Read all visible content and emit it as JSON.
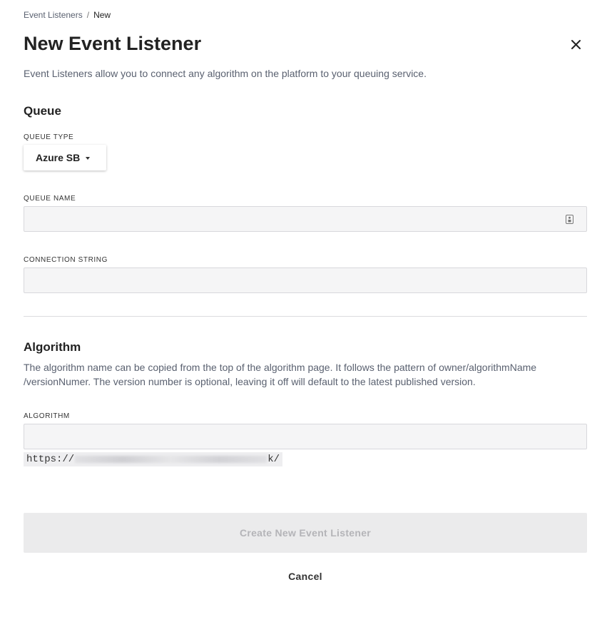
{
  "breadcrumb": {
    "parent": "Event Listeners",
    "separator": "/",
    "current": "New"
  },
  "header": {
    "title": "New Event Listener",
    "close_icon": "close-icon"
  },
  "subtitle": "Event Listeners allow you to connect any algorithm on the platform to your queuing service.",
  "queue": {
    "section_title": "Queue",
    "type_label": "QUEUE TYPE",
    "type_value": "Azure SB",
    "name_label": "QUEUE NAME",
    "name_value": "",
    "name_icon": "password-manager-icon",
    "connection_label": "CONNECTION STRING",
    "connection_value": ""
  },
  "algorithm": {
    "section_title": "Algorithm",
    "description": "The algorithm name can be copied from the top of the algorithm page. It follows the pattern of owner/algorithmName /versionNumer. The version number is optional, leaving it off will default to the latest published version.",
    "label": "ALGORITHM",
    "value": "",
    "url_prefix": "https://",
    "url_suffix": "k/"
  },
  "actions": {
    "create_label": "Create New Event Listener",
    "cancel_label": "Cancel"
  },
  "colors": {
    "muted_text": "#5a6170",
    "disabled_button_bg": "#ebebec",
    "disabled_button_text": "#b4b4b8",
    "input_bg": "#f5f5f6"
  }
}
